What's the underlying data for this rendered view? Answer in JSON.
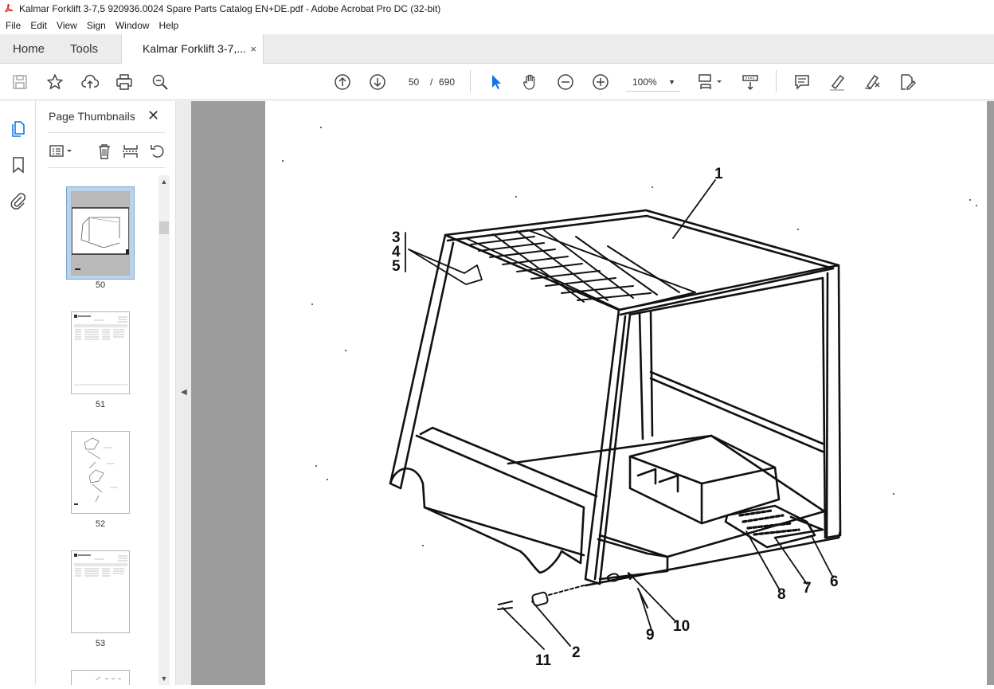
{
  "window": {
    "title": "Kalmar Forklift 3-7,5 920936.0024 Spare Parts Catalog EN+DE.pdf - Adobe Acrobat Pro DC (32-bit)"
  },
  "menu": [
    "File",
    "Edit",
    "View",
    "Sign",
    "Window",
    "Help"
  ],
  "tabs": {
    "home": "Home",
    "tools": "Tools",
    "document": "Kalmar Forklift 3-7,...",
    "close": "×"
  },
  "toolbar": {
    "current_page": "50",
    "page_separator": "/",
    "total_pages": "690",
    "zoom": "100%"
  },
  "panel": {
    "title": "Page Thumbnails",
    "close": "✕",
    "thumbnails": [
      {
        "label": "50",
        "selected": true
      },
      {
        "label": "51",
        "selected": false
      },
      {
        "label": "52",
        "selected": false
      },
      {
        "label": "53",
        "selected": false
      }
    ]
  },
  "drawing": {
    "callouts": [
      "1",
      "2",
      "3",
      "4",
      "5",
      "6",
      "7",
      "8",
      "9",
      "10",
      "11"
    ]
  }
}
